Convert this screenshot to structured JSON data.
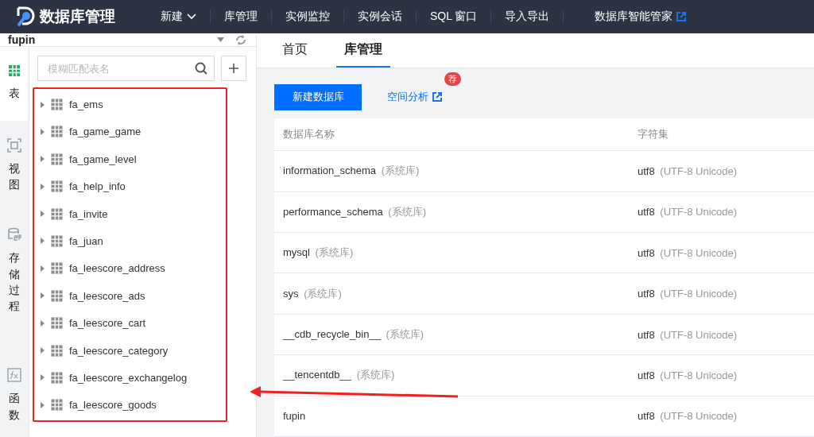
{
  "header": {
    "logo_text": "数据库管理",
    "nav": [
      {
        "label": "新建",
        "dropdown": true,
        "external": false
      },
      {
        "label": "库管理",
        "dropdown": false,
        "external": false
      },
      {
        "label": "实例监控",
        "dropdown": false,
        "external": false
      },
      {
        "label": "实例会话",
        "dropdown": false,
        "external": false
      },
      {
        "label": "SQL 窗口",
        "dropdown": false,
        "external": false
      },
      {
        "label": "导入导出",
        "dropdown": false,
        "external": false
      },
      {
        "label": "数据库智能管家",
        "dropdown": false,
        "external": true
      }
    ]
  },
  "sidebar": {
    "database": "fupin",
    "search": {
      "placeholder": "模糊匹配表名"
    },
    "rail": [
      {
        "kind": "table",
        "label": "表",
        "selected": true
      },
      {
        "kind": "view",
        "label": "视图",
        "selected": false
      },
      {
        "kind": "procedure",
        "label": "存储过程",
        "selected": false
      },
      {
        "kind": "function",
        "label": "函数",
        "selected": false
      }
    ],
    "tables": [
      "fa_ems",
      "fa_game_game",
      "fa_game_level",
      "fa_help_info",
      "fa_invite",
      "fa_juan",
      "fa_leescore_address",
      "fa_leescore_ads",
      "fa_leescore_cart",
      "fa_leescore_category",
      "fa_leescore_exchangelog",
      "fa_leescore_goods"
    ]
  },
  "tabs": [
    {
      "label": "首页",
      "selected": false
    },
    {
      "label": "库管理",
      "selected": true
    }
  ],
  "toolbar": {
    "create_button": "新建数据库",
    "space_link": "空间分析",
    "badge": "荐"
  },
  "table": {
    "columns": [
      "数据库名称",
      "字符集"
    ],
    "rows": [
      {
        "name": "information_schema",
        "tag": "(系统库)",
        "charset": "utf8",
        "charset_desc": "(UTF-8 Unicode)"
      },
      {
        "name": "performance_schema",
        "tag": "(系统库)",
        "charset": "utf8",
        "charset_desc": "(UTF-8 Unicode)"
      },
      {
        "name": "mysql",
        "tag": "(系统库)",
        "charset": "utf8",
        "charset_desc": "(UTF-8 Unicode)"
      },
      {
        "name": "sys",
        "tag": "(系统库)",
        "charset": "utf8",
        "charset_desc": "(UTF-8 Unicode)"
      },
      {
        "name": "__cdb_recycle_bin__",
        "tag": "(系统库)",
        "charset": "utf8",
        "charset_desc": "(UTF-8 Unicode)"
      },
      {
        "name": "__tencentdb__",
        "tag": "(系统库)",
        "charset": "utf8",
        "charset_desc": "(UTF-8 Unicode)"
      },
      {
        "name": "fupin",
        "charset": "utf8",
        "charset_desc": "(UTF-8 Unicode)"
      }
    ]
  }
}
